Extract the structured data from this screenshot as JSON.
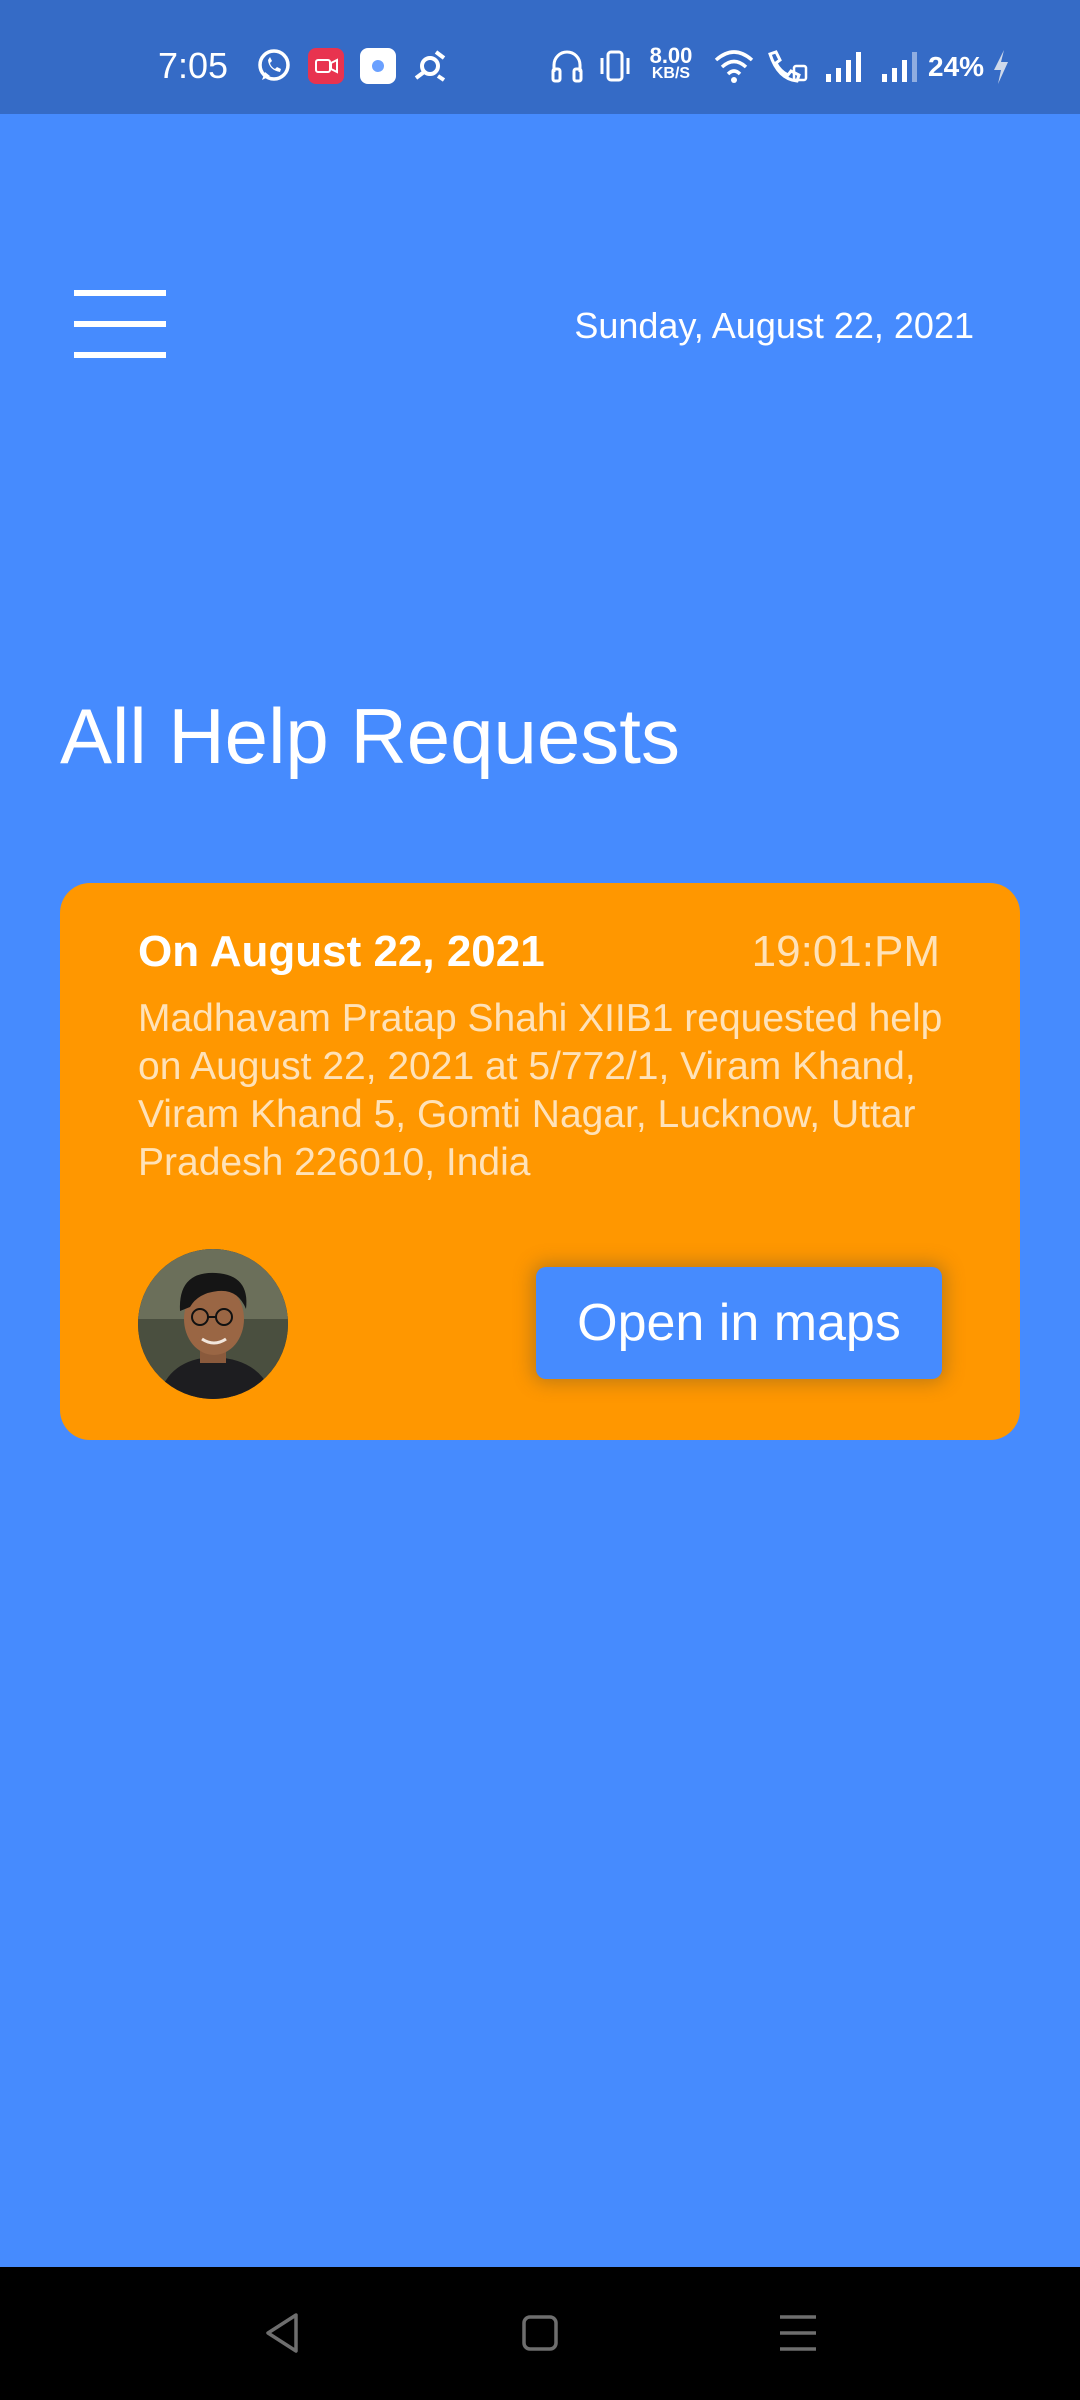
{
  "status_bar": {
    "time": "7:05",
    "net_speed": "8.00",
    "net_speed_unit": "KB/S",
    "battery": "24%",
    "icons": [
      "whatsapp-icon",
      "screen-record-icon",
      "app-icon",
      "notification-icon",
      "headset-icon",
      "vibrate-icon",
      "wifi-icon",
      "wifi-calling-icon",
      "signal-icon",
      "signal-icon-2",
      "charging-icon"
    ]
  },
  "header": {
    "menu_icon": "hamburger-menu-icon",
    "date": "Sunday, August 22, 2021"
  },
  "main": {
    "title": "All Help Requests",
    "requests": [
      {
        "date": "On August 22, 2021",
        "time": "19:01:PM",
        "description": "Madhavam Pratap Shahi XIIB1 requested help on August 22, 2021 at 5/772/1, Viram Khand, Viram Khand 5, Gomti Nagar, Lucknow, Uttar Pradesh 226010, India",
        "button_label": "Open in maps"
      }
    ]
  },
  "nav_bar": {
    "buttons": [
      "back-icon",
      "home-icon",
      "recents-icon"
    ]
  },
  "colors": {
    "background": "#468BFE",
    "status_bar": "#356BC6",
    "card": "#FF9700",
    "card_text_muted": "#FFE2B8"
  }
}
